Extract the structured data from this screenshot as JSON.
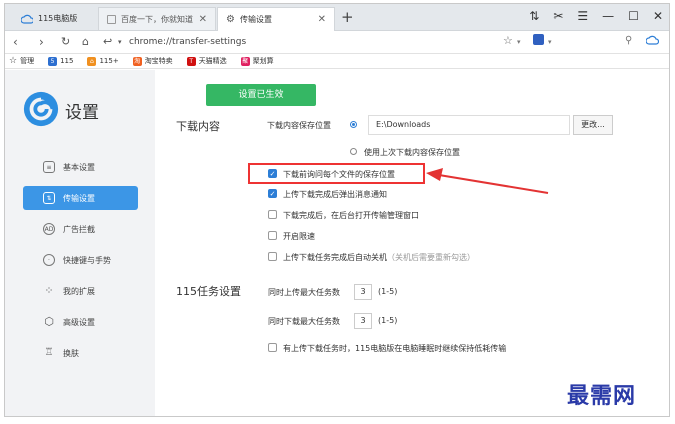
{
  "tabs": [
    {
      "label": "115电脑版"
    },
    {
      "label": "百度一下，你就知道"
    },
    {
      "label": "传输设置"
    }
  ],
  "address": {
    "url": "chrome://transfer-settings"
  },
  "bookmarks": [
    {
      "label": "管理",
      "color": "#f0a020"
    },
    {
      "label": "115",
      "color": "#2d6fd0"
    },
    {
      "label": "115+",
      "color": "#f09020"
    },
    {
      "label": "淘宝特卖",
      "color": "#f06020"
    },
    {
      "label": "天猫精选",
      "color": "#d01010"
    },
    {
      "label": "聚划算",
      "color": "#e02060"
    }
  ],
  "sidebar": {
    "title": "设置",
    "items": [
      {
        "label": "基本设置",
        "icon": "sliders-icon"
      },
      {
        "label": "传输设置",
        "icon": "transfer-icon",
        "active": true
      },
      {
        "label": "广告拦截",
        "icon": "adblock-icon"
      },
      {
        "label": "快捷键与手势",
        "icon": "mouse-icon"
      },
      {
        "label": "我的扩展",
        "icon": "extensions-icon"
      },
      {
        "label": "高级设置",
        "icon": "hexagon-gear-icon"
      },
      {
        "label": "换肤",
        "icon": "shirt-icon"
      }
    ]
  },
  "main": {
    "effective_button": "设置已生效",
    "download": {
      "section_title": "下载内容",
      "save_location_label": "下载内容保存位置",
      "path": "E:\\Downloads",
      "change_button": "更改...",
      "use_last_label": "使用上次下载内容保存位置",
      "options": [
        {
          "label": "下载前询问每个文件的保存位置",
          "checked": true
        },
        {
          "label": "上传下载完成后弹出消息通知",
          "checked": true
        },
        {
          "label": "下载完成后，在后台打开传输管理窗口",
          "checked": false
        },
        {
          "label": "开启限速",
          "checked": false
        },
        {
          "label": "上传下载任务完成后自动关机",
          "hint": "（关机后需要重新勾选）",
          "checked": false
        }
      ]
    },
    "task": {
      "section_title": "115任务设置",
      "upload_max_label": "同时上传最大任务数",
      "upload_max_value": "3",
      "upload_range": "(1-5)",
      "download_max_label": "同时下载最大任务数",
      "download_max_value": "3",
      "download_range": "(1-5)",
      "keep_awake_label": "有上传下载任务时，115电脑版在电脑睡眠时继续保持低耗传输",
      "keep_awake_checked": false
    }
  },
  "watermark": "最需网",
  "colors": {
    "accent": "#3c96e6",
    "green": "#35b764",
    "annotation": "#e33333"
  }
}
